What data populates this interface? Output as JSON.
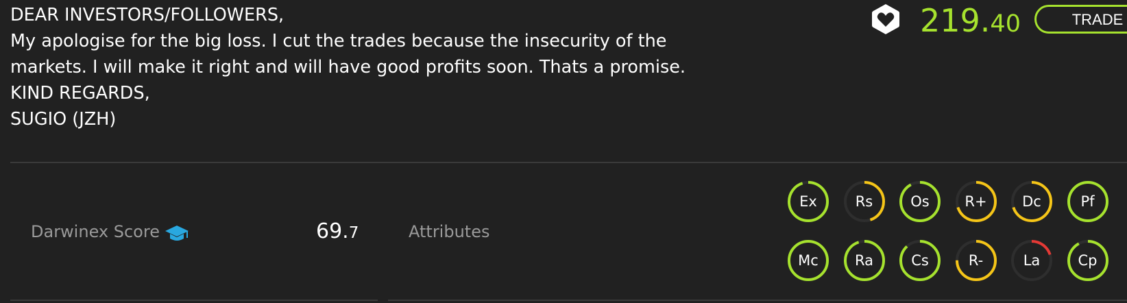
{
  "message": {
    "lines": [
      "DEAR INVESTORS/FOLLOWERS,",
      "My apologise for the big loss. I cut the trades because the insecurity of the",
      "markets. I will make it right and will have good profits soon. Thats a promise.",
      "KIND REGARDS,",
      "SUGIO (JZH)"
    ]
  },
  "header": {
    "price_int": "219.",
    "price_dec": "40",
    "trade_label": "TRADE",
    "favorite_icon": "heart-hexagon-icon"
  },
  "score": {
    "label": "Darwinex Score",
    "icon": "graduation-cap-icon",
    "value_int": "69.",
    "value_dec": "7"
  },
  "attributes": {
    "label": "Attributes",
    "items": [
      {
        "label": "Ex",
        "level": 0.95,
        "color": "#a6e22e"
      },
      {
        "label": "Rs",
        "level": 0.45,
        "color": "#f5c518"
      },
      {
        "label": "Os",
        "level": 0.92,
        "color": "#a6e22e"
      },
      {
        "label": "R+",
        "level": 0.7,
        "color": "#f5c518"
      },
      {
        "label": "Dc",
        "level": 0.7,
        "color": "#f5c518"
      },
      {
        "label": "Pf",
        "level": 1.0,
        "color": "#a6e22e"
      },
      {
        "label": "Mc",
        "level": 1.0,
        "color": "#a6e22e"
      },
      {
        "label": "Ra",
        "level": 0.95,
        "color": "#a6e22e"
      },
      {
        "label": "Cs",
        "level": 0.88,
        "color": "#a6e22e"
      },
      {
        "label": "R-",
        "level": 0.75,
        "color": "#f5c518"
      },
      {
        "label": "La",
        "level": 0.2,
        "color": "#e53935"
      },
      {
        "label": "Cp",
        "level": 0.92,
        "color": "#a6e22e"
      }
    ]
  },
  "colors": {
    "accent": "#a6e22e",
    "warning": "#f5c518",
    "danger": "#e53935",
    "info": "#29a8e0",
    "background": "#212121"
  }
}
